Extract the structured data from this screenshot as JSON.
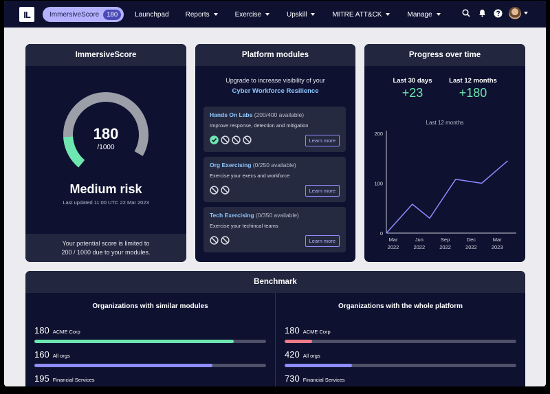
{
  "nav": {
    "score_label": "ImmersiveScore",
    "score_count": "180",
    "items": [
      {
        "label": "Launchpad",
        "dropdown": false
      },
      {
        "label": "Reports",
        "dropdown": true
      },
      {
        "label": "Exercise",
        "dropdown": true
      },
      {
        "label": "Upskill",
        "dropdown": true
      },
      {
        "label": "MITRE ATT&CK",
        "dropdown": true
      },
      {
        "label": "Manage",
        "dropdown": true
      }
    ]
  },
  "score_card": {
    "title": "ImmersiveScore",
    "score": "180",
    "max": "/1000",
    "score_fraction": 0.18,
    "risk": "Medium risk",
    "updated": "Last updated 11:00 UTC 22 Mar 2023",
    "footer_line1": "Your potential score is limited to",
    "footer_line2": "200 / 1000 due to your modules."
  },
  "modules_card": {
    "title": "Platform modules",
    "upgrade_text": "Upgrade to increase visibility of your",
    "upgrade_link": "Cyber Workforce Resilience",
    "modules": [
      {
        "name": "Hands On Labs",
        "avail": "(200/400 available)",
        "desc": "Improve response, detection and mitigation",
        "button": "Learn more"
      },
      {
        "name": "Org Exercising",
        "avail": "(0/250 available)",
        "desc": "Exercise your execs and workforce",
        "button": "Learn more"
      },
      {
        "name": "Tech Exercising",
        "avail": "(0/350 available)",
        "desc": "Exercise your techincal teams",
        "button": "Learn more"
      }
    ]
  },
  "progress_card": {
    "title": "Progress over time",
    "stat1_label": "Last 30 days",
    "stat1_value": "+23",
    "stat2_label": "Last 12 months",
    "stat2_value": "+180",
    "chart_label": "Last 12 months"
  },
  "chart_data": {
    "type": "line",
    "x_ticks": [
      [
        "Mar",
        "2022"
      ],
      [
        "Jun",
        "2022"
      ],
      [
        "Sep",
        "2022"
      ],
      [
        "Dec",
        "2022"
      ],
      [
        "Mar",
        "2023"
      ]
    ],
    "y_ticks": [
      "200",
      "100",
      "0"
    ],
    "ylim": [
      0,
      200
    ],
    "x": [
      0,
      3,
      5,
      8,
      11,
      14
    ],
    "xlim": [
      0,
      15
    ],
    "values": [
      0,
      58,
      30,
      108,
      100,
      145
    ],
    "color": "#8e8cff"
  },
  "benchmark": {
    "title": "Benchmark",
    "left": {
      "title": "Organizations with similar modules",
      "rows": [
        {
          "value": "180",
          "org": "ACME Corp",
          "fraction": 0.86,
          "color": "#6ee6b0"
        },
        {
          "value": "160",
          "org": "All orgs",
          "fraction": 0.77,
          "color": "#8e8cff"
        },
        {
          "value": "195",
          "org": "Financial Services",
          "fraction": 0.9,
          "color": "#8e8cff"
        }
      ]
    },
    "right": {
      "title": "Organizations with the whole platform",
      "rows": [
        {
          "value": "180",
          "org": "ACME Corp",
          "fraction": 0.12,
          "color": "#f07a8a"
        },
        {
          "value": "420",
          "org": "All orgs",
          "fraction": 0.29,
          "color": "#8e8cff"
        },
        {
          "value": "730",
          "org": "Financial Services",
          "fraction": 0.5,
          "color": "#8e8cff"
        }
      ]
    }
  },
  "colors": {
    "navy": "#0e1230",
    "accent": "#b4b2ff",
    "green": "#6ee6b0"
  }
}
